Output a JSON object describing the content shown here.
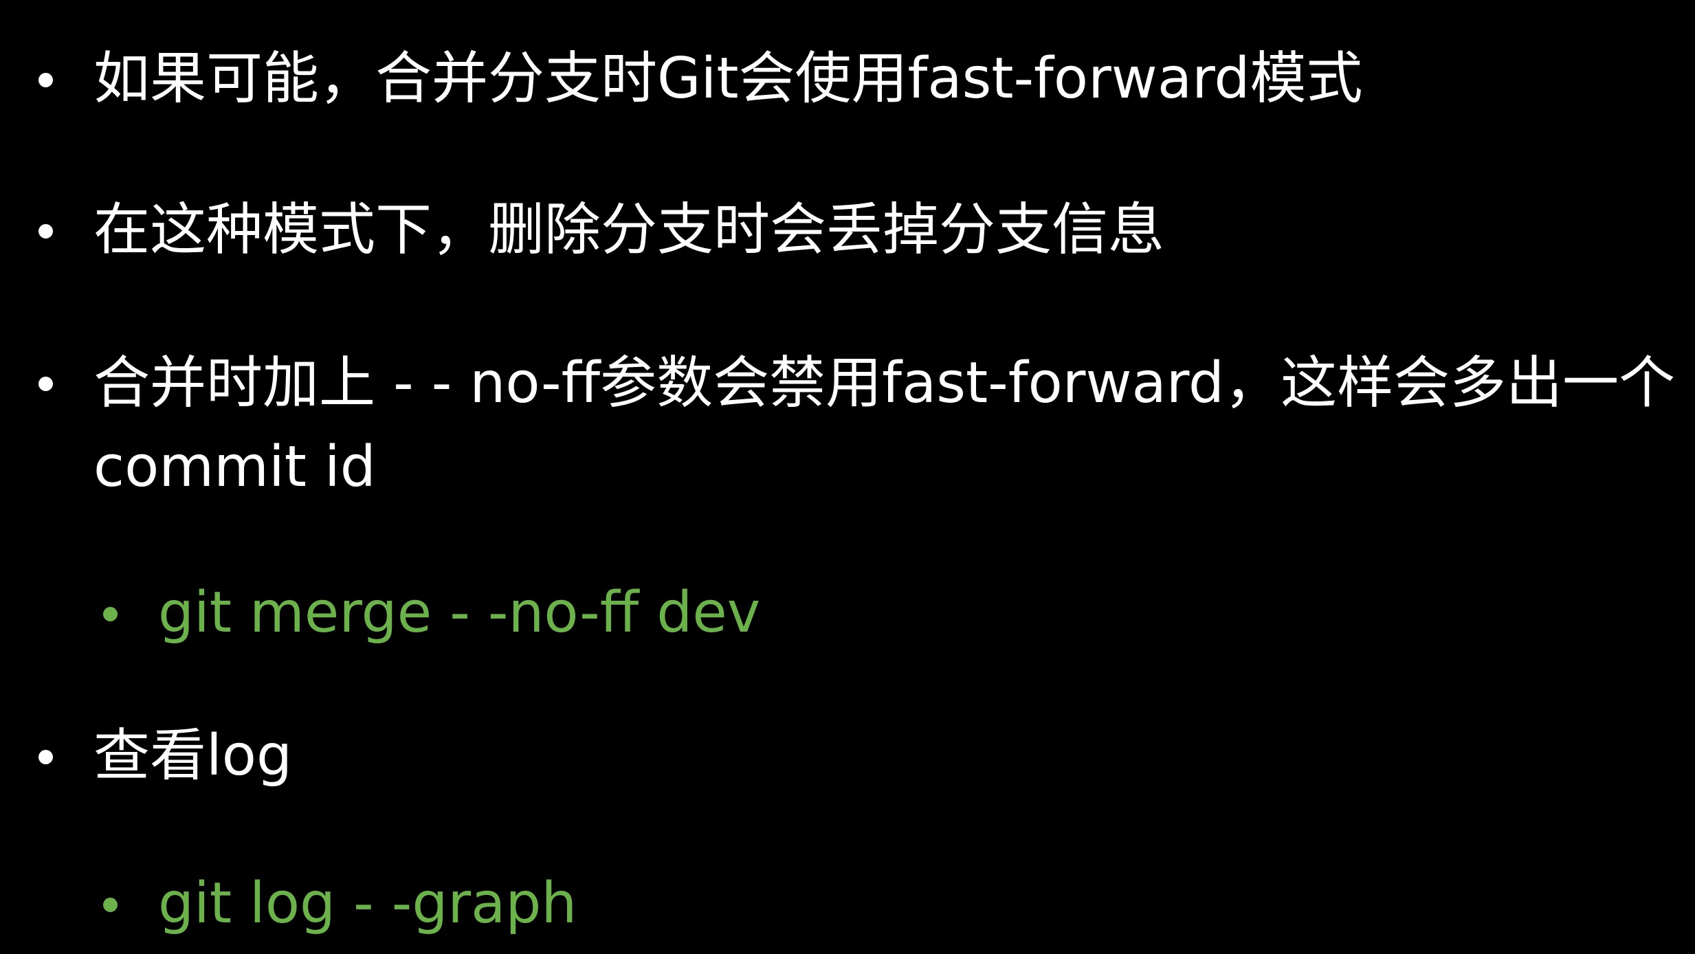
{
  "slide": {
    "background_color": "#000000",
    "text_color": "#ffffff",
    "accent_color": "#6cb24a",
    "items": [
      {
        "text": "如果可能，合并分支时Git会使用fast-forward模式",
        "level": 1
      },
      {
        "text": "在这种模式下，删除分支时会丢掉分支信息",
        "level": 1
      },
      {
        "text": "合并时加上 - - no-ff参数会禁用fast-forward，这样会多出一个commit id",
        "level": 1
      },
      {
        "text": "git merge - -no-ff dev",
        "level": 2
      },
      {
        "text": "查看log",
        "level": 1
      },
      {
        "text": "git log - -graph",
        "level": 2
      }
    ]
  }
}
